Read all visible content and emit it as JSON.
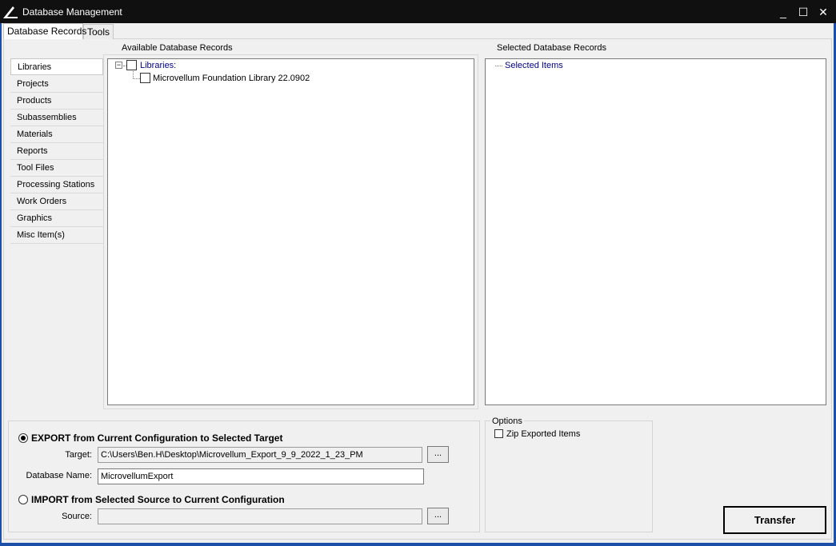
{
  "window": {
    "title": "Database Management",
    "controls": {
      "minimize": "_",
      "maximize": "☐",
      "close": "✕"
    }
  },
  "tabs": [
    {
      "label": "Database Records",
      "active": true
    },
    {
      "label": "Tools",
      "active": false
    }
  ],
  "available": {
    "title": "Available Database Records",
    "tree": {
      "root_label": "Libraries:",
      "expander": "−",
      "children": [
        {
          "label": "Microvellum Foundation Library 22.0902",
          "checked": false
        }
      ]
    }
  },
  "selected": {
    "title": "Selected Database Records",
    "root_label": "Selected Items"
  },
  "categories": [
    {
      "label": "Libraries",
      "active": true
    },
    {
      "label": "Projects"
    },
    {
      "label": "Products"
    },
    {
      "label": "Subassemblies"
    },
    {
      "label": "Materials"
    },
    {
      "label": "Reports"
    },
    {
      "label": "Tool Files"
    },
    {
      "label": "Processing Stations"
    },
    {
      "label": "Work Orders"
    },
    {
      "label": "Graphics"
    },
    {
      "label": "Misc Item(s)"
    }
  ],
  "transfer": {
    "export_label": "EXPORT from Current Configuration to Selected Target",
    "export_selected": true,
    "target_label": "Target:",
    "target_value": "C:\\Users\\Ben.H\\Desktop\\Microvellum_Export_9_9_2022_1_23_PM",
    "browse_label": "...",
    "dbname_label": "Database Name:",
    "dbname_value": "MicrovellumExport",
    "import_label": "IMPORT from Selected Source to Current Configuration",
    "source_label": "Source:",
    "source_value": ""
  },
  "options": {
    "title": "Options",
    "zip_label": "Zip Exported Items",
    "zip_checked": false
  },
  "transfer_button": "Transfer",
  "colors": {
    "titlebar": "#101010",
    "window_border": "#1b4fa8",
    "tree_link": "#00008b"
  }
}
